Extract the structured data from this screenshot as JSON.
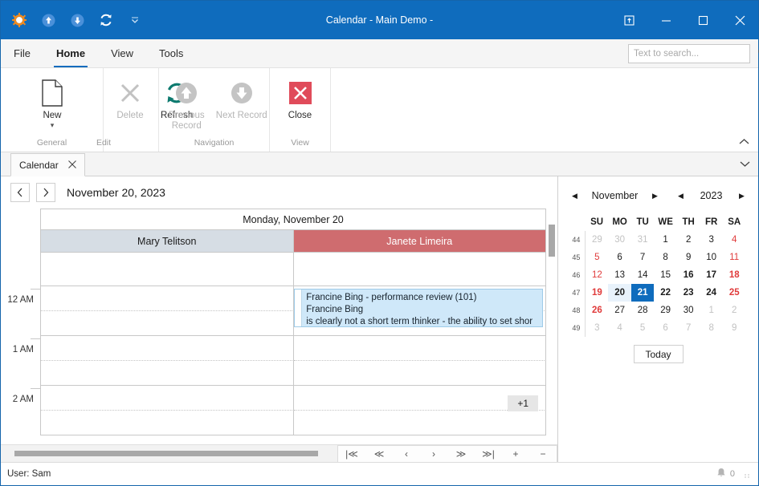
{
  "window": {
    "title": "Calendar - Main Demo -",
    "quick_access": [
      "settings-sun-icon",
      "upload-arrow-icon",
      "download-arrow-icon",
      "refresh-icon",
      "qat-dropdown-icon"
    ],
    "controls": [
      "restore-down-icon",
      "minimize-icon",
      "maximize-icon",
      "close-icon"
    ],
    "accent": "#0f6cbd"
  },
  "ribbon": {
    "tabs": [
      {
        "label": "File",
        "active": false
      },
      {
        "label": "Home",
        "active": true
      },
      {
        "label": "View",
        "active": false
      },
      {
        "label": "Tools",
        "active": false
      }
    ],
    "search": {
      "placeholder": "Text to search...",
      "value": ""
    },
    "collapse_icon": "chevron-up-icon",
    "groups": [
      {
        "label": "General",
        "buttons": [
          {
            "label": "New",
            "icon": "new-document-icon",
            "disabled": false,
            "has_caret": true
          }
        ]
      },
      {
        "label": "Edit",
        "buttons": [
          {
            "label": "Delete",
            "icon": "delete-x-icon",
            "disabled": true,
            "has_caret": false
          },
          {
            "label": "Refresh",
            "icon": "refresh-circular-icon",
            "disabled": false,
            "has_caret": false
          }
        ]
      },
      {
        "label": "Navigation",
        "buttons": [
          {
            "label": "Previous Record",
            "icon": "up-arrow-circle-icon",
            "disabled": true,
            "has_caret": false
          },
          {
            "label": "Next Record",
            "icon": "down-arrow-circle-icon",
            "disabled": true,
            "has_caret": false
          }
        ]
      },
      {
        "label": "View",
        "buttons": [
          {
            "label": "Close",
            "icon": "close-red-x-icon",
            "disabled": false,
            "has_caret": false
          }
        ]
      }
    ]
  },
  "doc_tabs": {
    "tabs": [
      {
        "label": "Calendar",
        "active": true,
        "close_icon": "close-icon"
      }
    ],
    "overflow_icon": "chevron-down-icon"
  },
  "calendar": {
    "nav": {
      "prev_icon": "chevron-left-icon",
      "next_icon": "chevron-right-icon"
    },
    "current_date": "November 20, 2023",
    "day_header": "Monday, November 20",
    "resources": [
      {
        "name": "Mary Telitson",
        "color": "#d6dde4",
        "text_color": "#1b1b1b"
      },
      {
        "name": "Janete Limeira",
        "color": "#cf6c6f",
        "text_color": "#ffffff"
      }
    ],
    "time_labels": [
      "12 AM",
      "1 AM",
      "2 AM"
    ],
    "appointments": [
      {
        "resource": "Janete Limeira",
        "lines": [
          "Francine Bing - performance review (101)",
          "Francine Bing",
          "is clearly not a short term thinker - the ability to set shor"
        ],
        "bg": "#cfe8f9"
      }
    ],
    "overflow_badge": "+1"
  },
  "record_nav": {
    "buttons": [
      {
        "icon": "first-record-icon",
        "label": "|≪"
      },
      {
        "icon": "prev-page-icon",
        "label": "≪"
      },
      {
        "icon": "prev-record-icon",
        "label": "‹"
      },
      {
        "icon": "next-record-icon",
        "label": "›"
      },
      {
        "icon": "next-page-icon",
        "label": "≫"
      },
      {
        "icon": "last-record-icon",
        "label": "≫|"
      },
      {
        "icon": "add-record-icon",
        "label": "+"
      },
      {
        "icon": "remove-record-icon",
        "label": "−"
      }
    ]
  },
  "date_navigator": {
    "month": "November",
    "year": "2023",
    "month_prev_icon": "triangle-left-icon",
    "month_next_icon": "triangle-right-icon",
    "year_prev_icon": "triangle-left-icon",
    "year_next_icon": "triangle-right-icon",
    "weekday_headers": [
      "SU",
      "MO",
      "TU",
      "WE",
      "TH",
      "FR",
      "SA"
    ],
    "week_numbers": [
      "44",
      "45",
      "46",
      "47",
      "48",
      "49"
    ],
    "weeks": [
      [
        {
          "d": "29",
          "state": "dim"
        },
        {
          "d": "30",
          "state": "dim"
        },
        {
          "d": "31",
          "state": "dim"
        },
        {
          "d": "1",
          "state": "normal"
        },
        {
          "d": "2",
          "state": "normal"
        },
        {
          "d": "3",
          "state": "normal"
        },
        {
          "d": "4",
          "state": "weekend"
        }
      ],
      [
        {
          "d": "5",
          "state": "weekend"
        },
        {
          "d": "6",
          "state": "normal"
        },
        {
          "d": "7",
          "state": "normal"
        },
        {
          "d": "8",
          "state": "normal"
        },
        {
          "d": "9",
          "state": "normal"
        },
        {
          "d": "10",
          "state": "normal"
        },
        {
          "d": "11",
          "state": "weekend"
        }
      ],
      [
        {
          "d": "12",
          "state": "weekend"
        },
        {
          "d": "13",
          "state": "normal"
        },
        {
          "d": "14",
          "state": "normal"
        },
        {
          "d": "15",
          "state": "normal"
        },
        {
          "d": "16",
          "state": "bold"
        },
        {
          "d": "17",
          "state": "bold"
        },
        {
          "d": "18",
          "state": "weekend-bold"
        }
      ],
      [
        {
          "d": "19",
          "state": "weekend-bold"
        },
        {
          "d": "20",
          "state": "highlight"
        },
        {
          "d": "21",
          "state": "selected"
        },
        {
          "d": "22",
          "state": "bold"
        },
        {
          "d": "23",
          "state": "bold"
        },
        {
          "d": "24",
          "state": "bold"
        },
        {
          "d": "25",
          "state": "weekend-bold"
        }
      ],
      [
        {
          "d": "26",
          "state": "weekend-bold"
        },
        {
          "d": "27",
          "state": "normal"
        },
        {
          "d": "28",
          "state": "normal"
        },
        {
          "d": "29",
          "state": "normal"
        },
        {
          "d": "30",
          "state": "normal"
        },
        {
          "d": "1",
          "state": "dim"
        },
        {
          "d": "2",
          "state": "dim"
        }
      ],
      [
        {
          "d": "3",
          "state": "dim"
        },
        {
          "d": "4",
          "state": "dim"
        },
        {
          "d": "5",
          "state": "dim"
        },
        {
          "d": "6",
          "state": "dim"
        },
        {
          "d": "7",
          "state": "dim"
        },
        {
          "d": "8",
          "state": "dim"
        },
        {
          "d": "9",
          "state": "dim"
        }
      ]
    ],
    "today_label": "Today"
  },
  "status_bar": {
    "user": "User: Sam",
    "bell_icon": "notification-bell-icon",
    "notification_count": "0",
    "grip_icon": "resize-grip-icon"
  }
}
